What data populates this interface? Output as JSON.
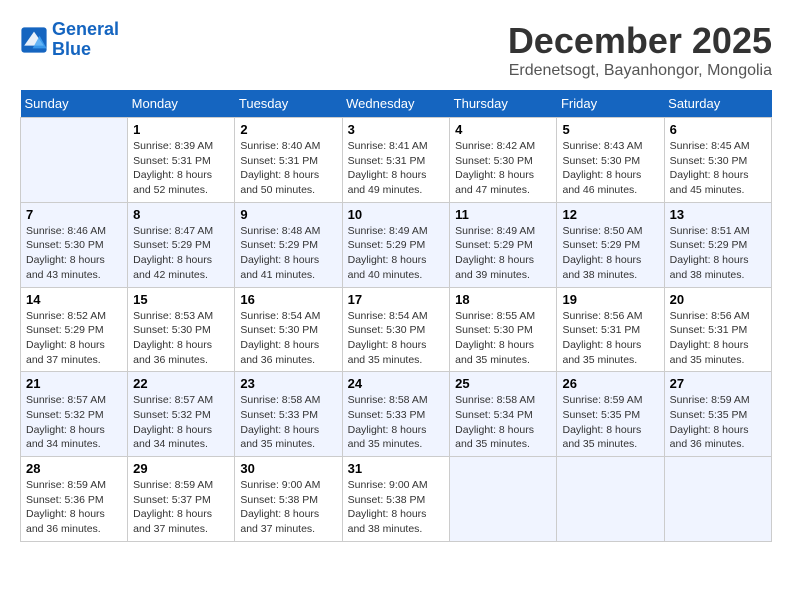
{
  "logo": {
    "line1": "General",
    "line2": "Blue"
  },
  "title": "December 2025",
  "subtitle": "Erdenetsogt, Bayanhongor, Mongolia",
  "weekdays": [
    "Sunday",
    "Monday",
    "Tuesday",
    "Wednesday",
    "Thursday",
    "Friday",
    "Saturday"
  ],
  "weeks": [
    [
      {
        "day": "",
        "sunrise": "",
        "sunset": "",
        "daylight": ""
      },
      {
        "day": "1",
        "sunrise": "Sunrise: 8:39 AM",
        "sunset": "Sunset: 5:31 PM",
        "daylight": "Daylight: 8 hours and 52 minutes."
      },
      {
        "day": "2",
        "sunrise": "Sunrise: 8:40 AM",
        "sunset": "Sunset: 5:31 PM",
        "daylight": "Daylight: 8 hours and 50 minutes."
      },
      {
        "day": "3",
        "sunrise": "Sunrise: 8:41 AM",
        "sunset": "Sunset: 5:31 PM",
        "daylight": "Daylight: 8 hours and 49 minutes."
      },
      {
        "day": "4",
        "sunrise": "Sunrise: 8:42 AM",
        "sunset": "Sunset: 5:30 PM",
        "daylight": "Daylight: 8 hours and 47 minutes."
      },
      {
        "day": "5",
        "sunrise": "Sunrise: 8:43 AM",
        "sunset": "Sunset: 5:30 PM",
        "daylight": "Daylight: 8 hours and 46 minutes."
      },
      {
        "day": "6",
        "sunrise": "Sunrise: 8:45 AM",
        "sunset": "Sunset: 5:30 PM",
        "daylight": "Daylight: 8 hours and 45 minutes."
      }
    ],
    [
      {
        "day": "7",
        "sunrise": "Sunrise: 8:46 AM",
        "sunset": "Sunset: 5:30 PM",
        "daylight": "Daylight: 8 hours and 43 minutes."
      },
      {
        "day": "8",
        "sunrise": "Sunrise: 8:47 AM",
        "sunset": "Sunset: 5:29 PM",
        "daylight": "Daylight: 8 hours and 42 minutes."
      },
      {
        "day": "9",
        "sunrise": "Sunrise: 8:48 AM",
        "sunset": "Sunset: 5:29 PM",
        "daylight": "Daylight: 8 hours and 41 minutes."
      },
      {
        "day": "10",
        "sunrise": "Sunrise: 8:49 AM",
        "sunset": "Sunset: 5:29 PM",
        "daylight": "Daylight: 8 hours and 40 minutes."
      },
      {
        "day": "11",
        "sunrise": "Sunrise: 8:49 AM",
        "sunset": "Sunset: 5:29 PM",
        "daylight": "Daylight: 8 hours and 39 minutes."
      },
      {
        "day": "12",
        "sunrise": "Sunrise: 8:50 AM",
        "sunset": "Sunset: 5:29 PM",
        "daylight": "Daylight: 8 hours and 38 minutes."
      },
      {
        "day": "13",
        "sunrise": "Sunrise: 8:51 AM",
        "sunset": "Sunset: 5:29 PM",
        "daylight": "Daylight: 8 hours and 38 minutes."
      }
    ],
    [
      {
        "day": "14",
        "sunrise": "Sunrise: 8:52 AM",
        "sunset": "Sunset: 5:29 PM",
        "daylight": "Daylight: 8 hours and 37 minutes."
      },
      {
        "day": "15",
        "sunrise": "Sunrise: 8:53 AM",
        "sunset": "Sunset: 5:30 PM",
        "daylight": "Daylight: 8 hours and 36 minutes."
      },
      {
        "day": "16",
        "sunrise": "Sunrise: 8:54 AM",
        "sunset": "Sunset: 5:30 PM",
        "daylight": "Daylight: 8 hours and 36 minutes."
      },
      {
        "day": "17",
        "sunrise": "Sunrise: 8:54 AM",
        "sunset": "Sunset: 5:30 PM",
        "daylight": "Daylight: 8 hours and 35 minutes."
      },
      {
        "day": "18",
        "sunrise": "Sunrise: 8:55 AM",
        "sunset": "Sunset: 5:30 PM",
        "daylight": "Daylight: 8 hours and 35 minutes."
      },
      {
        "day": "19",
        "sunrise": "Sunrise: 8:56 AM",
        "sunset": "Sunset: 5:31 PM",
        "daylight": "Daylight: 8 hours and 35 minutes."
      },
      {
        "day": "20",
        "sunrise": "Sunrise: 8:56 AM",
        "sunset": "Sunset: 5:31 PM",
        "daylight": "Daylight: 8 hours and 35 minutes."
      }
    ],
    [
      {
        "day": "21",
        "sunrise": "Sunrise: 8:57 AM",
        "sunset": "Sunset: 5:32 PM",
        "daylight": "Daylight: 8 hours and 34 minutes."
      },
      {
        "day": "22",
        "sunrise": "Sunrise: 8:57 AM",
        "sunset": "Sunset: 5:32 PM",
        "daylight": "Daylight: 8 hours and 34 minutes."
      },
      {
        "day": "23",
        "sunrise": "Sunrise: 8:58 AM",
        "sunset": "Sunset: 5:33 PM",
        "daylight": "Daylight: 8 hours and 35 minutes."
      },
      {
        "day": "24",
        "sunrise": "Sunrise: 8:58 AM",
        "sunset": "Sunset: 5:33 PM",
        "daylight": "Daylight: 8 hours and 35 minutes."
      },
      {
        "day": "25",
        "sunrise": "Sunrise: 8:58 AM",
        "sunset": "Sunset: 5:34 PM",
        "daylight": "Daylight: 8 hours and 35 minutes."
      },
      {
        "day": "26",
        "sunrise": "Sunrise: 8:59 AM",
        "sunset": "Sunset: 5:35 PM",
        "daylight": "Daylight: 8 hours and 35 minutes."
      },
      {
        "day": "27",
        "sunrise": "Sunrise: 8:59 AM",
        "sunset": "Sunset: 5:35 PM",
        "daylight": "Daylight: 8 hours and 36 minutes."
      }
    ],
    [
      {
        "day": "28",
        "sunrise": "Sunrise: 8:59 AM",
        "sunset": "Sunset: 5:36 PM",
        "daylight": "Daylight: 8 hours and 36 minutes."
      },
      {
        "day": "29",
        "sunrise": "Sunrise: 8:59 AM",
        "sunset": "Sunset: 5:37 PM",
        "daylight": "Daylight: 8 hours and 37 minutes."
      },
      {
        "day": "30",
        "sunrise": "Sunrise: 9:00 AM",
        "sunset": "Sunset: 5:38 PM",
        "daylight": "Daylight: 8 hours and 37 minutes."
      },
      {
        "day": "31",
        "sunrise": "Sunrise: 9:00 AM",
        "sunset": "Sunset: 5:38 PM",
        "daylight": "Daylight: 8 hours and 38 minutes."
      },
      {
        "day": "",
        "sunrise": "",
        "sunset": "",
        "daylight": ""
      },
      {
        "day": "",
        "sunrise": "",
        "sunset": "",
        "daylight": ""
      },
      {
        "day": "",
        "sunrise": "",
        "sunset": "",
        "daylight": ""
      }
    ]
  ]
}
